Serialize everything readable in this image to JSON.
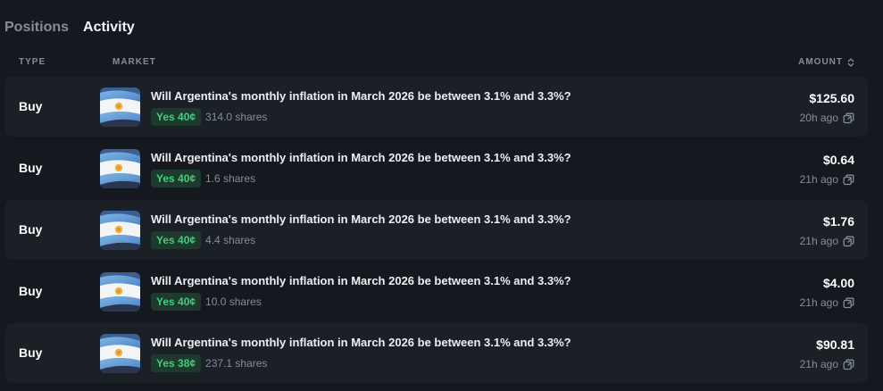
{
  "tabs": [
    {
      "label": "Positions",
      "active": false
    },
    {
      "label": "Activity",
      "active": true
    }
  ],
  "table": {
    "columns": {
      "type": "TYPE",
      "market": "MARKET",
      "amount": "AMOUNT"
    },
    "rows": [
      {
        "type": "Buy",
        "market": "Will Argentina's monthly inflation in March 2026 be between 3.1% and 3.3%?",
        "outcome": "Yes 40¢",
        "shares": "314.0 shares",
        "amount": "$125.60",
        "time": "20h ago",
        "thumb_icon": "argentina-flag"
      },
      {
        "type": "Buy",
        "market": "Will Argentina's monthly inflation in March 2026 be between 3.1% and 3.3%?",
        "outcome": "Yes 40¢",
        "shares": "1.6 shares",
        "amount": "$0.64",
        "time": "21h ago",
        "thumb_icon": "argentina-flag"
      },
      {
        "type": "Buy",
        "market": "Will Argentina's monthly inflation in March 2026 be between 3.1% and 3.3%?",
        "outcome": "Yes 40¢",
        "shares": "4.4 shares",
        "amount": "$1.76",
        "time": "21h ago",
        "thumb_icon": "argentina-flag"
      },
      {
        "type": "Buy",
        "market": "Will Argentina's monthly inflation in March 2026 be between 3.1% and 3.3%?",
        "outcome": "Yes 40¢",
        "shares": "10.0 shares",
        "amount": "$4.00",
        "time": "21h ago",
        "thumb_icon": "argentina-flag"
      },
      {
        "type": "Buy",
        "market": "Will Argentina's monthly inflation in March 2026 be between 3.1% and 3.3%?",
        "outcome": "Yes 38¢",
        "shares": "237.1 shares",
        "amount": "$90.81",
        "time": "21h ago",
        "thumb_icon": "argentina-flag"
      }
    ]
  },
  "colors": {
    "background": "#15191f",
    "row_shade": "#1b2027",
    "yes_badge_bg": "#1d3a2d",
    "yes_badge_text": "#3fcf7f",
    "muted_text": "#858d98"
  }
}
